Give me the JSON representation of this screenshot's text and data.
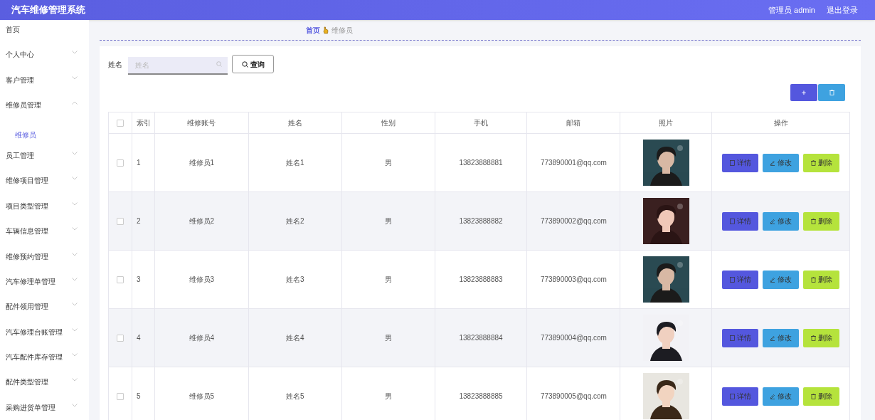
{
  "header": {
    "title": "汽车维修管理系统",
    "user": "管理员 admin",
    "logout": "退出登录"
  },
  "sidebar": {
    "items": [
      {
        "label": "首页",
        "kind": "link",
        "selected": false
      },
      {
        "label": "个人中心",
        "kind": "group",
        "expanded": false
      },
      {
        "label": "客户管理",
        "kind": "group",
        "expanded": false
      },
      {
        "label": "维修员管理",
        "kind": "group",
        "expanded": true,
        "children": [
          {
            "label": "维修员",
            "selected": true
          }
        ]
      },
      {
        "label": "员工管理",
        "kind": "group",
        "expanded": false
      },
      {
        "label": "维修项目管理",
        "kind": "group",
        "expanded": false
      },
      {
        "label": "项目类型管理",
        "kind": "group",
        "expanded": false
      },
      {
        "label": "车辆信息管理",
        "kind": "group",
        "expanded": false
      },
      {
        "label": "维修预约管理",
        "kind": "group",
        "expanded": false
      },
      {
        "label": "汽车修理单管理",
        "kind": "group",
        "expanded": false
      },
      {
        "label": "配件领用管理",
        "kind": "group",
        "expanded": false
      },
      {
        "label": "汽车修理台账管理",
        "kind": "group",
        "expanded": false
      },
      {
        "label": "汽车配件库存管理",
        "kind": "group",
        "expanded": false
      },
      {
        "label": "配件类型管理",
        "kind": "group",
        "expanded": false
      },
      {
        "label": "采购进货单管理",
        "kind": "group",
        "expanded": false
      }
    ]
  },
  "breadcrumb": [
    "首页",
    "维修员"
  ],
  "search": {
    "label": "姓名",
    "placeholder": "姓名",
    "button": "查询"
  },
  "toolbar": {
    "add": "+"
  },
  "table": {
    "all_checked": false,
    "columns": [
      "索引",
      "维修账号",
      "姓名",
      "性别",
      "手机",
      "邮箱",
      "照片",
      "操作"
    ],
    "rows": [
      {
        "index": "1",
        "account": "维修员1",
        "name": "姓名1",
        "gender": "男",
        "phone": "13823888881",
        "email": "773890001@qq.com",
        "checked": false,
        "actions": [
          "详情",
          "修改",
          "删除"
        ]
      },
      {
        "index": "2",
        "account": "维修员2",
        "name": "姓名2",
        "gender": "男",
        "phone": "13823888882",
        "email": "773890002@qq.com",
        "checked": false,
        "actions": [
          "详情",
          "修改",
          "删除"
        ]
      },
      {
        "index": "3",
        "account": "维修员3",
        "name": "姓名3",
        "gender": "男",
        "phone": "13823888883",
        "email": "773890003@qq.com",
        "checked": false,
        "actions": [
          "详情",
          "修改",
          "删除"
        ]
      },
      {
        "index": "4",
        "account": "维修员4",
        "name": "姓名4",
        "gender": "男",
        "phone": "13823888884",
        "email": "773890004@qq.com",
        "checked": false,
        "actions": [
          "详情",
          "修改",
          "删除"
        ]
      },
      {
        "index": "5",
        "account": "维修员5",
        "name": "姓名5",
        "gender": "男",
        "phone": "13823888885",
        "email": "773890005@qq.com",
        "checked": false,
        "actions": [
          "详情",
          "修改",
          "删除"
        ]
      }
    ]
  }
}
